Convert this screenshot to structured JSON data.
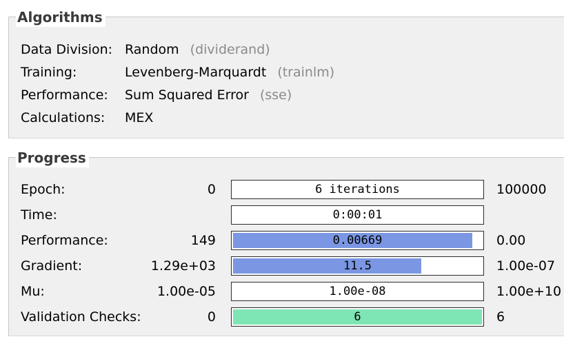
{
  "algorithms": {
    "title": "Algorithms",
    "rows": [
      {
        "key": "Data Division:",
        "value": "Random",
        "code": "(dividerand)"
      },
      {
        "key": "Training:",
        "value": "Levenberg-Marquardt",
        "code": "(trainlm)"
      },
      {
        "key": "Performance:",
        "value": "Sum Squared Error",
        "code": "(sse)"
      },
      {
        "key": "Calculations:",
        "value": "MEX",
        "code": ""
      }
    ]
  },
  "progress": {
    "title": "Progress",
    "fill_color": "#7b97e3",
    "check_color": "#7ee6b5",
    "rows": [
      {
        "label": "Epoch:",
        "min": "0",
        "bar": "6 iterations",
        "max": "100000",
        "fill": 0
      },
      {
        "label": "Time:",
        "min": "",
        "bar": "0:00:01",
        "max": "",
        "fill": 0
      },
      {
        "label": "Performance:",
        "min": "149",
        "bar": "0.00669",
        "max": "0.00",
        "fill": 0.96
      },
      {
        "label": "Gradient:",
        "min": "1.29e+03",
        "bar": "11.5",
        "max": "1.00e-07",
        "fill": 0.755
      },
      {
        "label": "Mu:",
        "min": "1.00e-05",
        "bar": "1.00e-08",
        "max": "1.00e+10",
        "fill": 0
      },
      {
        "label": "Validation Checks:",
        "min": "0",
        "bar": "6",
        "max": "6",
        "fill": 1.0
      }
    ]
  }
}
